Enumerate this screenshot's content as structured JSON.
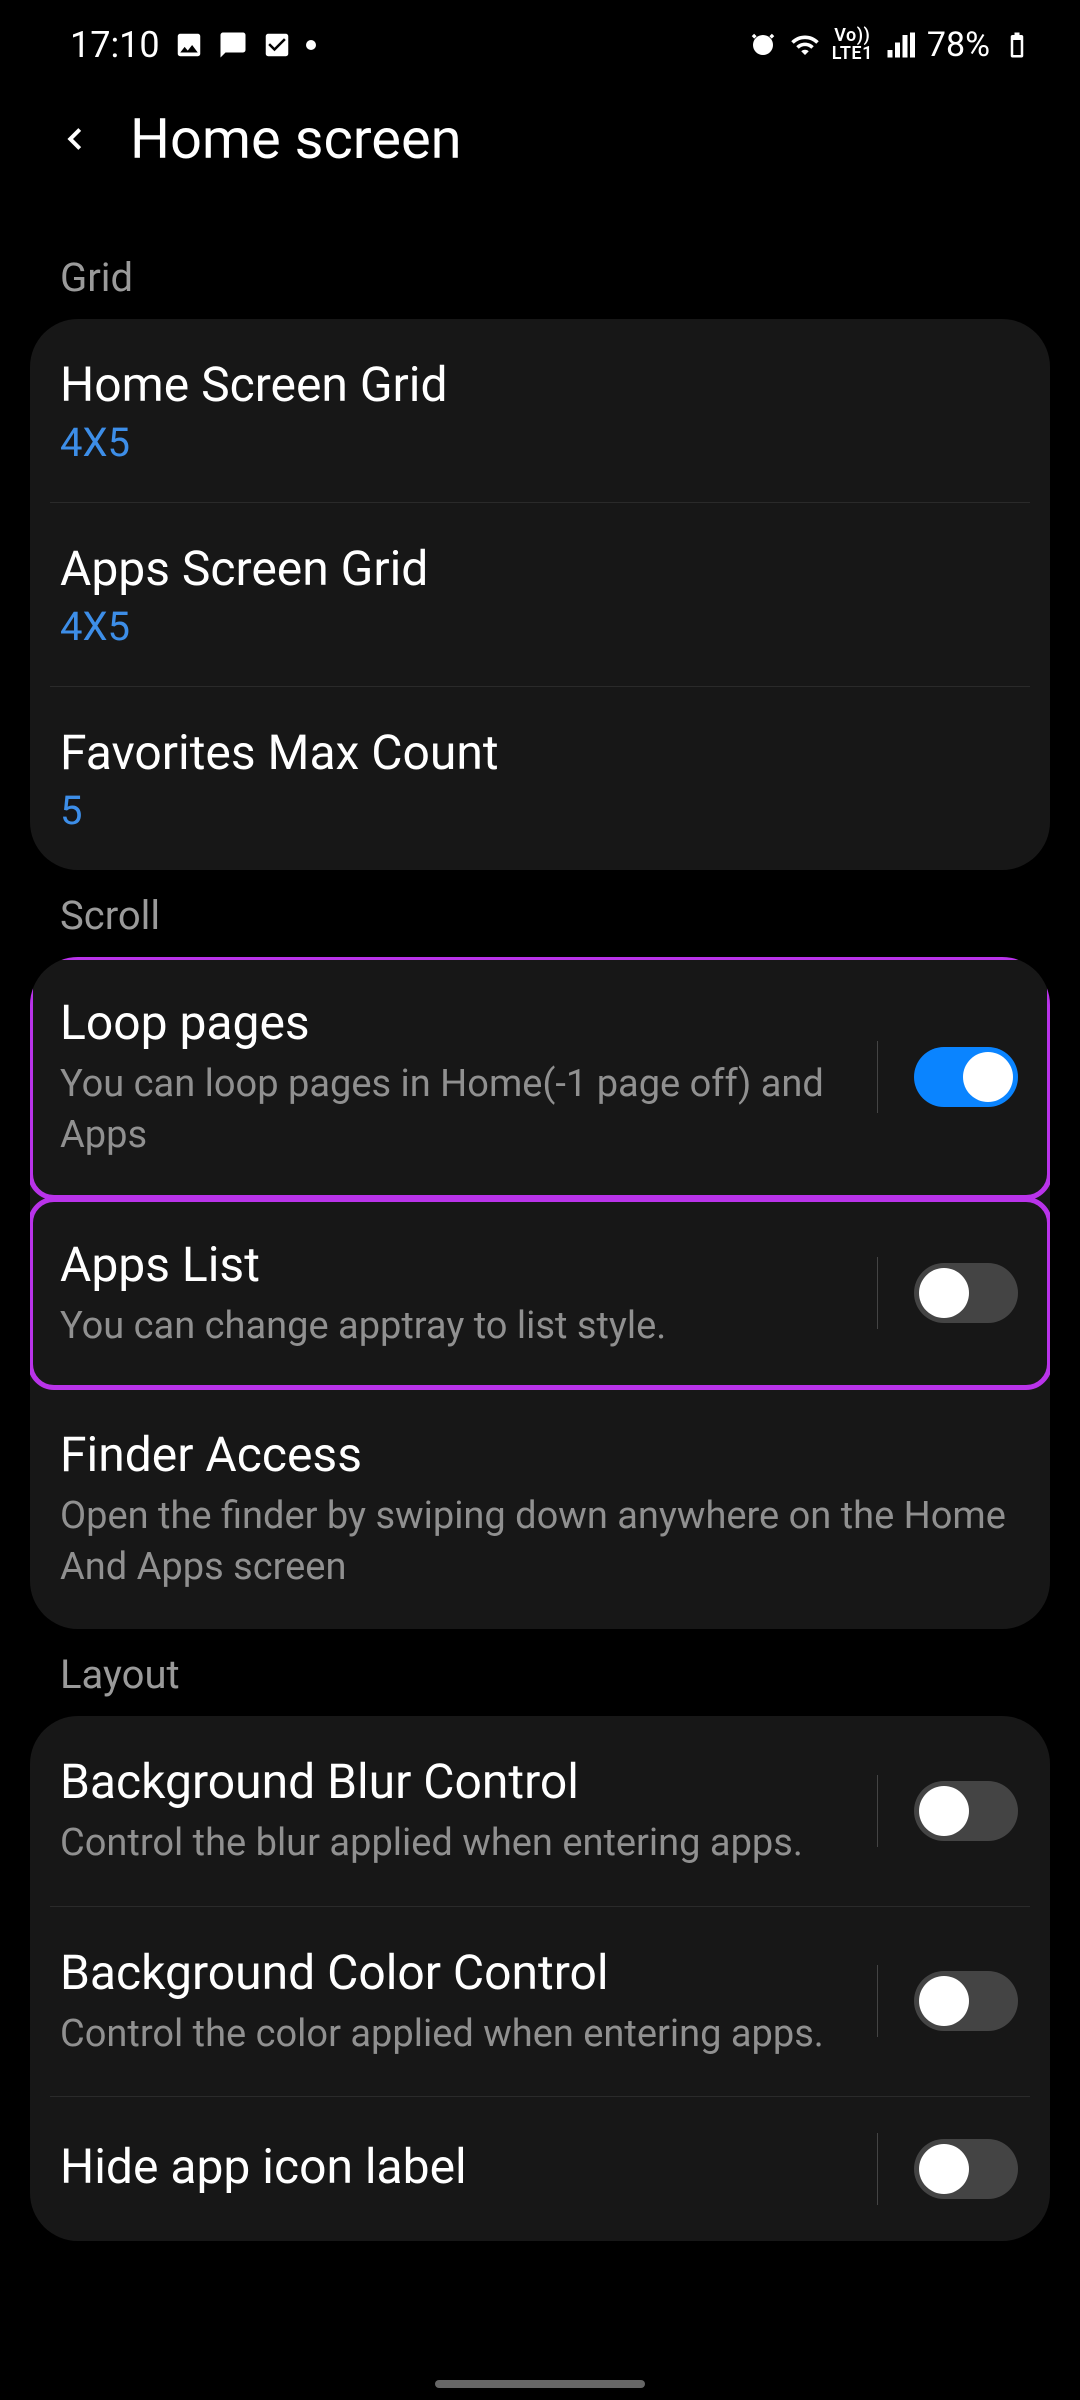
{
  "statusbar": {
    "time": "17:10",
    "battery": "78%"
  },
  "header": {
    "title": "Home screen"
  },
  "sections": {
    "grid": {
      "label": "Grid",
      "home_grid_title": "Home Screen Grid",
      "home_grid_value": "4X5",
      "apps_grid_title": "Apps Screen Grid",
      "apps_grid_value": "4X5",
      "fav_title": "Favorites Max Count",
      "fav_value": "5"
    },
    "scroll": {
      "label": "Scroll",
      "loop_title": "Loop pages",
      "loop_desc": "You can loop pages in Home(-1 page off) and Apps",
      "apps_list_title": "Apps List",
      "apps_list_desc": "You can change apptray to list style.",
      "finder_title": "Finder Access",
      "finder_desc": "Open the finder by swiping down anywhere on the Home And Apps screen"
    },
    "layout": {
      "label": "Layout",
      "blur_title": "Background Blur Control",
      "blur_desc": "Control the blur applied when entering apps.",
      "color_title": "Background Color Control",
      "color_desc": "Control the color applied when entering apps.",
      "hide_title": "Hide app icon label"
    }
  }
}
